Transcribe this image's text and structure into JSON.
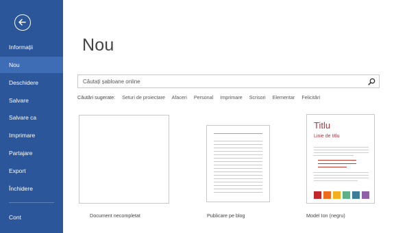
{
  "sidebar": {
    "items": [
      {
        "label": "Informații",
        "active": false
      },
      {
        "label": "Nou",
        "active": true
      },
      {
        "label": "Deschidere",
        "active": false
      },
      {
        "label": "Salvare",
        "active": false
      },
      {
        "label": "Salvare ca",
        "active": false
      },
      {
        "label": "Imprimare",
        "active": false
      },
      {
        "label": "Partajare",
        "active": false
      },
      {
        "label": "Export",
        "active": false
      },
      {
        "label": "Închidere",
        "active": false
      },
      {
        "label": "Cont",
        "active": false
      }
    ],
    "back_icon": "back-arrow-icon",
    "color": "#2b579a",
    "active_color": "#3e6db5"
  },
  "main": {
    "title": "Nou",
    "search": {
      "placeholder": "Căutați șabloane online",
      "value": "",
      "icon": "search-icon"
    },
    "suggested": {
      "label": "Căutări sugerate:",
      "items": [
        "Seturi de proiectare",
        "Afaceri",
        "Personal",
        "Imprimare",
        "Scrisori",
        "Elementar",
        "Felicitări"
      ]
    },
    "templates": [
      {
        "caption": "Document necompletat"
      },
      {
        "caption": "Publicare pe blog"
      },
      {
        "caption": "Model Ion (negru)",
        "preview_title": "Titlu",
        "preview_subtitle": "Linie de titlu",
        "swatches": [
          "#c0282d",
          "#ee6a1f",
          "#f2b01e",
          "#5fb089",
          "#3c7d9a",
          "#8f5fa8"
        ]
      }
    ]
  }
}
